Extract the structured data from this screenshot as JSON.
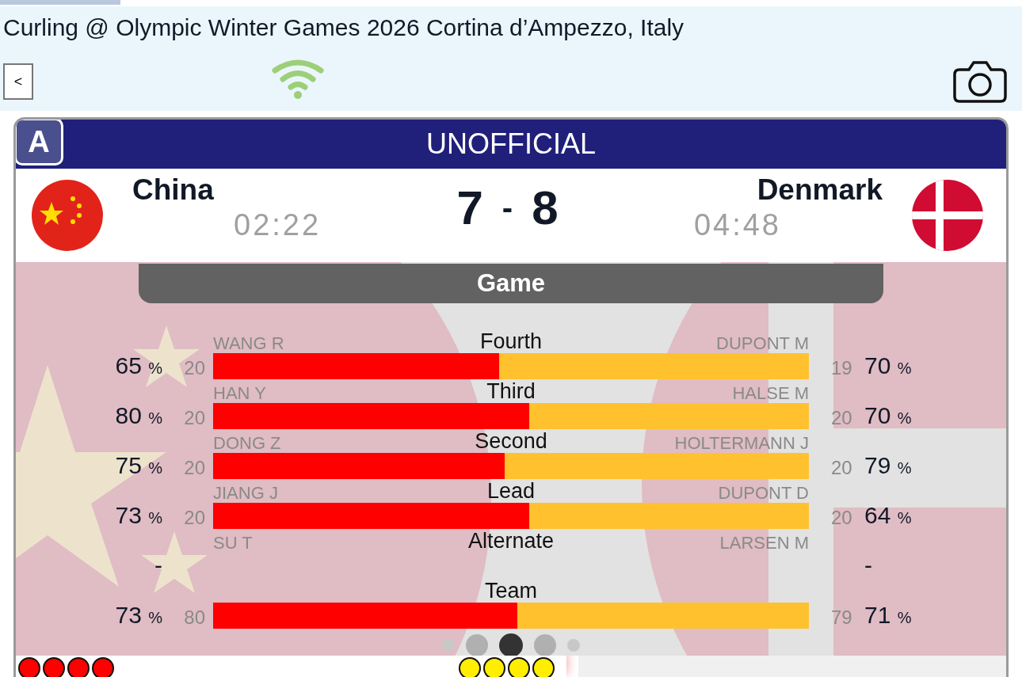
{
  "header": {
    "title": "Curling @ Olympic Winter Games 2026 Cortina d’Ampezzo, Italy",
    "back_button": "<"
  },
  "scoreboard": {
    "badge": "A",
    "status": "UNOFFICIAL",
    "separator": "-",
    "home": {
      "name": "China",
      "time": "02:22",
      "score": "7"
    },
    "away": {
      "name": "Denmark",
      "time": "04:48",
      "score": "8"
    }
  },
  "section": {
    "title": "Game"
  },
  "rows": [
    {
      "kind": "bar",
      "position": "Fourth",
      "home_player": "WANG R",
      "home_pct": "65",
      "home_unit": "%",
      "home_shots": "20",
      "away_player": "DUPONT M",
      "away_shots": "19",
      "away_pct": "70",
      "away_unit": "%",
      "level": 0.48
    },
    {
      "kind": "bar",
      "position": "Third",
      "home_player": "HAN Y",
      "home_pct": "80",
      "home_unit": "%",
      "home_shots": "20",
      "away_player": "HALSE M",
      "away_shots": "20",
      "away_pct": "70",
      "away_unit": "%",
      "level": 0.53
    },
    {
      "kind": "bar",
      "position": "Second",
      "home_player": "DONG Z",
      "home_pct": "75",
      "home_unit": "%",
      "home_shots": "20",
      "away_player": "HOLTERMANN J",
      "away_shots": "20",
      "away_pct": "79",
      "away_unit": "%",
      "level": 0.49
    },
    {
      "kind": "bar",
      "position": "Lead",
      "home_player": "JIANG J",
      "home_pct": "73",
      "home_unit": "%",
      "home_shots": "20",
      "away_player": "DUPONT D",
      "away_shots": "20",
      "away_pct": "64",
      "away_unit": "%",
      "level": 0.53
    },
    {
      "kind": "empty",
      "position": "Alternate",
      "home_player": "SU T",
      "home_pct": "-",
      "away_player": "LARSEN M",
      "away_pct": "-"
    },
    {
      "kind": "bar",
      "position": "Team",
      "home_pct": "73",
      "home_unit": "%",
      "home_shots": "80",
      "away_shots": "79",
      "away_pct": "71",
      "away_unit": "%",
      "level": 0.51
    }
  ],
  "pager": [
    {
      "selected": false
    },
    {
      "selected": false
    },
    {
      "selected": true
    },
    {
      "selected": false
    },
    {
      "selected": false
    }
  ],
  "stones": {
    "home": [
      {
        "color": "#ff0000"
      },
      {
        "color": "#ff0000"
      },
      {
        "color": "#ff0000"
      },
      {
        "color": "#ff0000"
      }
    ],
    "away": [
      {
        "color": "#ffee00"
      },
      {
        "color": "#ffee00"
      },
      {
        "color": "#ffee00"
      },
      {
        "color": "#ffee00"
      }
    ]
  }
}
